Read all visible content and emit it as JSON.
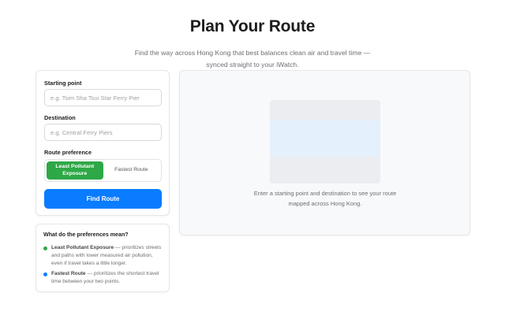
{
  "header": {
    "title": "Plan Your Route",
    "subtitle": "Find the way across Hong Kong that best balances clean air and travel time — synced straight to your iWatch."
  },
  "form": {
    "start_label": "Starting point",
    "start_placeholder": "e.g. Tsim Sha Tsui Star Ferry Pier",
    "start_value": "",
    "destination_label": "Destination",
    "destination_placeholder": "e.g. Central Ferry Piers",
    "destination_value": "",
    "preference_label": "Route preference",
    "options": [
      {
        "label": "Least Pollutant Exposure",
        "active": true
      },
      {
        "label": "Fastest Route",
        "active": false
      }
    ],
    "submit_label": "Find Route"
  },
  "info": {
    "title": "What do the preferences mean?",
    "items": [
      {
        "name": "Least Pollutant Exposure",
        "desc": " — prioritizes streets and paths with lower measured air pollution, even if travel takes a little longer.",
        "color": "#2ea846"
      },
      {
        "name": "Fastest Route",
        "desc": " — prioritizes the shortest travel time between your two points.",
        "color": "#0a7cff"
      }
    ]
  },
  "map": {
    "caption": "Enter a starting point and destination to see your route mapped across Hong Kong."
  },
  "colors": {
    "accent_green": "#2ea846",
    "accent_blue": "#0a7cff"
  }
}
